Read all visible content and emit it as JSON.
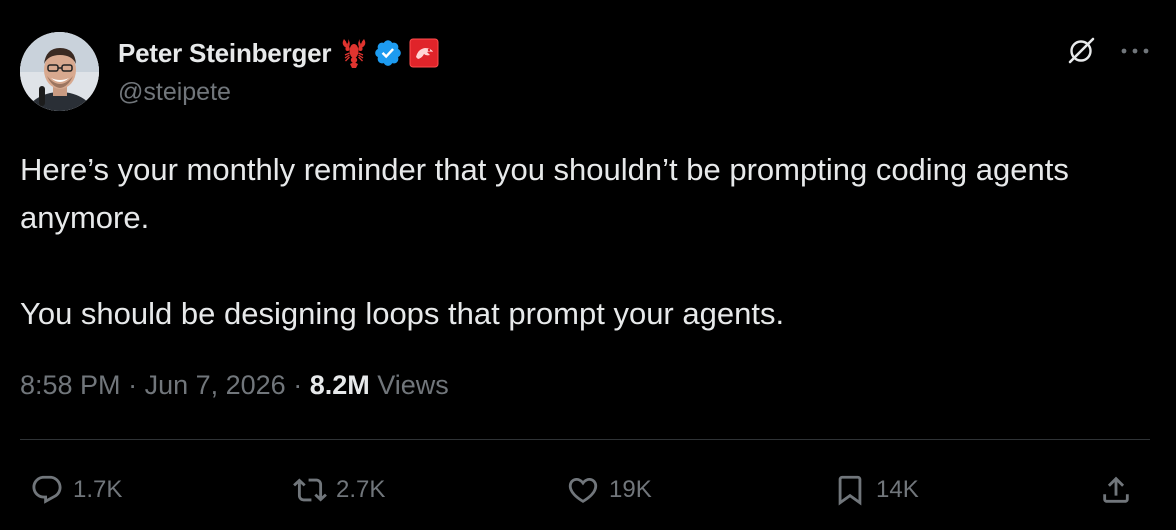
{
  "author": {
    "display_name": "Peter Steinberger",
    "handle": "@steipete",
    "emoji": "lobster",
    "verified": true,
    "avatar": "avatar-photo"
  },
  "tweet": {
    "text": "Here’s your monthly reminder that you shouldn’t be prompting coding agents anymore.\n\nYou should be designing loops that prompt your agents.",
    "time": "8:58 PM",
    "separator": " · ",
    "date": "Jun 7, 2026",
    "views_count": "8.2M",
    "views_label": " Views"
  },
  "actions": {
    "reply_count": "1.7K",
    "retweet_count": "2.7K",
    "like_count": "19K",
    "bookmark_count": "14K"
  },
  "icons": {
    "top_right": [
      "grok-icon",
      "more-icon"
    ],
    "actions": [
      "reply-icon",
      "retweet-icon",
      "like-icon",
      "bookmark-icon",
      "share-icon"
    ]
  },
  "colors": {
    "background": "#000000",
    "text_primary": "#e7e9ea",
    "text_secondary": "#71767b",
    "verified_blue": "#1d9bf0",
    "affiliate_red": "#e0242a",
    "divider": "#2f3336"
  }
}
